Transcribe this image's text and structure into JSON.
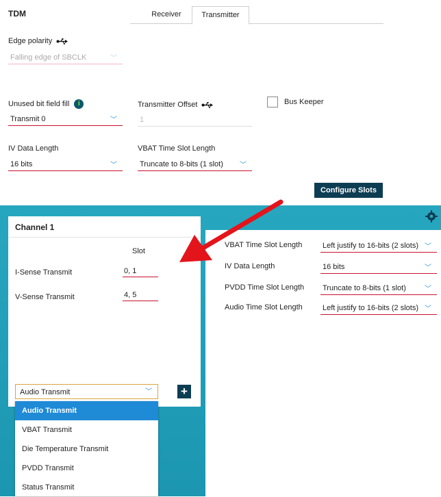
{
  "header": {
    "title": "TDM"
  },
  "tabs": [
    {
      "label": "Receiver"
    },
    {
      "label": "Transmitter"
    }
  ],
  "edge_polarity": {
    "label": "Edge polarity",
    "value": "Falling edge of SBCLK"
  },
  "unused_bit_field_fill": {
    "label": "Unused bit field fill",
    "value": "Transmit 0"
  },
  "transmitter_offset": {
    "label": "Transmitter Offset",
    "value": "1"
  },
  "bus_keeper": {
    "label": "Bus Keeper"
  },
  "iv_data_length": {
    "label": "IV Data Length",
    "value": "16 bits"
  },
  "vbat_slot_length": {
    "label": "VBAT Time Slot Length",
    "value": "Truncate to 8-bits (1 slot)"
  },
  "configure_button": {
    "label": "Configure Slots"
  },
  "channel": {
    "title": "Channel 1",
    "slot_header": "Slot",
    "rows": [
      {
        "label": "I-Sense Transmit",
        "value": "0, 1"
      },
      {
        "label": "V-Sense Transmit",
        "value": "4, 5"
      }
    ],
    "add_select": {
      "value": "Audio Transmit"
    },
    "menu": [
      {
        "label": "Audio Transmit"
      },
      {
        "label": "VBAT Transmit"
      },
      {
        "label": "Die Temperature Transmit"
      },
      {
        "label": "PVDD Transmit"
      },
      {
        "label": "Status Transmit"
      }
    ]
  },
  "slot_config": {
    "rows": [
      {
        "label": "VBAT Time Slot Length",
        "value": "Left justify to 16-bits (2 slots)"
      },
      {
        "label": "IV Data Length",
        "value": "16 bits"
      },
      {
        "label": "PVDD Time Slot Length",
        "value": "Truncate to 8-bits (1 slot)"
      },
      {
        "label": "Audio Time Slot Length",
        "value": "Left justify to 16-bits (2 slots)"
      }
    ]
  },
  "colors": {
    "accent": "#c8102e",
    "dark_button": "#0d3d52",
    "teal": "#1f9bb5",
    "highlight": "#1f8ad6"
  }
}
